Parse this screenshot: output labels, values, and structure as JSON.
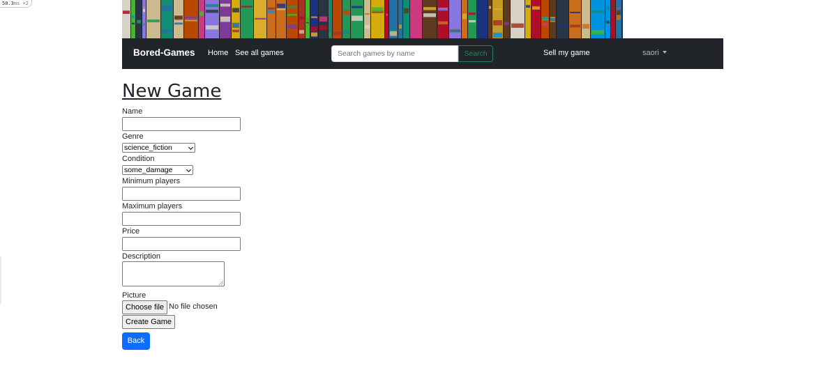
{
  "perf_badge": {
    "value": "50.3",
    "unit": "ms ×2"
  },
  "navbar": {
    "brand": "Bored-Games",
    "links": [
      "Home",
      "See all games"
    ],
    "search": {
      "placeholder": "Search games by name",
      "value": "",
      "button": "Search"
    },
    "sell_link": "Sell my game",
    "user": "saori"
  },
  "page_title": "New Game",
  "form": {
    "name_label": "Name",
    "name_value": "",
    "genre_label": "Genre",
    "genre_value": "science_fiction",
    "condition_label": "Condition",
    "condition_value": "some_damage",
    "min_players_label": "Minimum players",
    "min_players_value": "",
    "max_players_label": "Maximum players",
    "max_players_value": "",
    "price_label": "Price",
    "price_value": "",
    "description_label": "Description",
    "picture_label": "Picture",
    "file_button": "Choose file",
    "file_status": "No file chosen",
    "submit": "Create Game"
  },
  "back_button": "Back",
  "colors": {
    "navbar": "#212529",
    "search_button": "#198754",
    "back_button": "#0d6efd"
  }
}
